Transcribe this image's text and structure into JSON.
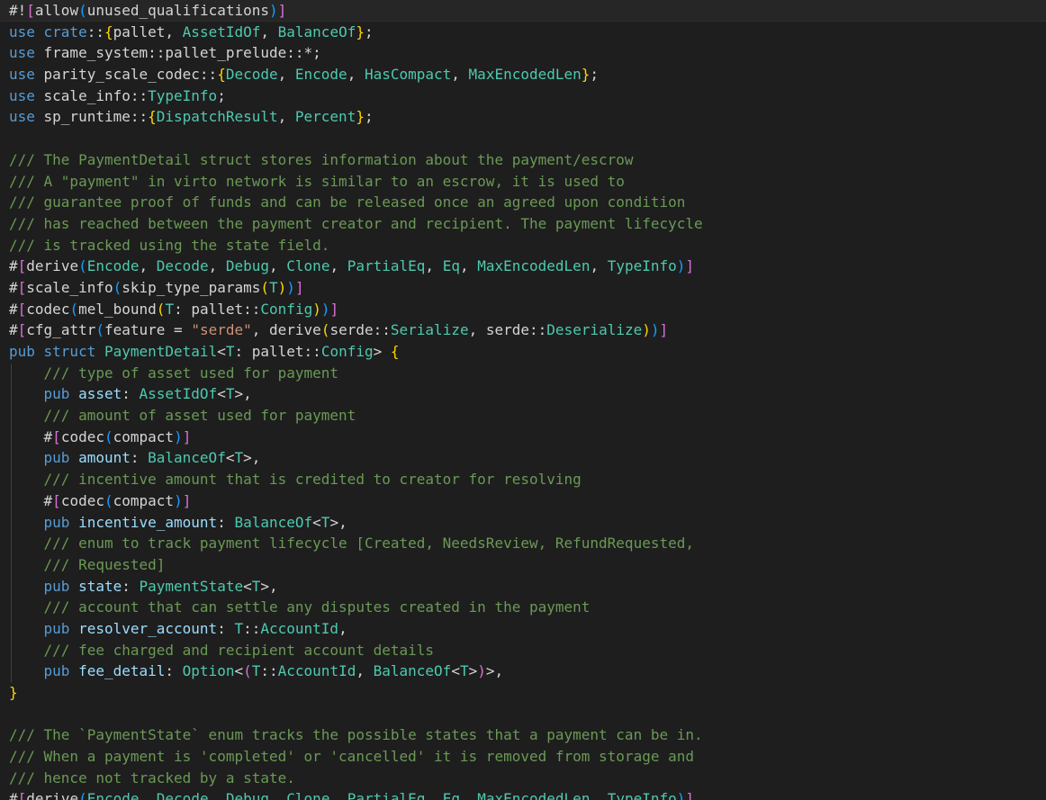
{
  "editor": {
    "lines": [
      [
        [
          "pl",
          "#!"
        ],
        [
          "b2",
          "["
        ],
        [
          "pl",
          "allow"
        ],
        [
          "b3",
          "("
        ],
        [
          "pl",
          "unused_qualifications"
        ],
        [
          "b3",
          ")"
        ],
        [
          "b2",
          "]"
        ]
      ],
      [
        [
          "kw",
          "use "
        ],
        [
          "kw",
          "crate"
        ],
        [
          "pl",
          "::"
        ],
        [
          "b1",
          "{"
        ],
        [
          "pl",
          "pallet, "
        ],
        [
          "ty",
          "AssetIdOf"
        ],
        [
          "pl",
          ", "
        ],
        [
          "ty",
          "BalanceOf"
        ],
        [
          "b1",
          "}"
        ],
        [
          "pl",
          ";"
        ]
      ],
      [
        [
          "kw",
          "use "
        ],
        [
          "pl",
          "frame_system::pallet_prelude::*;"
        ]
      ],
      [
        [
          "kw",
          "use "
        ],
        [
          "pl",
          "parity_scale_codec::"
        ],
        [
          "b1",
          "{"
        ],
        [
          "ty",
          "Decode"
        ],
        [
          "pl",
          ", "
        ],
        [
          "ty",
          "Encode"
        ],
        [
          "pl",
          ", "
        ],
        [
          "ty",
          "HasCompact"
        ],
        [
          "pl",
          ", "
        ],
        [
          "ty",
          "MaxEncodedLen"
        ],
        [
          "b1",
          "}"
        ],
        [
          "pl",
          ";"
        ]
      ],
      [
        [
          "kw",
          "use "
        ],
        [
          "pl",
          "scale_info::"
        ],
        [
          "ty",
          "TypeInfo"
        ],
        [
          "pl",
          ";"
        ]
      ],
      [
        [
          "kw",
          "use "
        ],
        [
          "pl",
          "sp_runtime::"
        ],
        [
          "b1",
          "{"
        ],
        [
          "ty",
          "DispatchResult"
        ],
        [
          "pl",
          ", "
        ],
        [
          "ty",
          "Percent"
        ],
        [
          "b1",
          "}"
        ],
        [
          "pl",
          ";"
        ]
      ],
      [],
      [
        [
          "cm",
          "/// The PaymentDetail struct stores information about the payment/escrow"
        ]
      ],
      [
        [
          "cm",
          "/// A \"payment\" in virto network is similar to an escrow, it is used to"
        ]
      ],
      [
        [
          "cm",
          "/// guarantee proof of funds and can be released once an agreed upon condition"
        ]
      ],
      [
        [
          "cm",
          "/// has reached between the payment creator and recipient. The payment lifecycle"
        ]
      ],
      [
        [
          "cm",
          "/// is tracked using the state field."
        ]
      ],
      [
        [
          "pl",
          "#"
        ],
        [
          "b2",
          "["
        ],
        [
          "pl",
          "derive"
        ],
        [
          "b3",
          "("
        ],
        [
          "ty",
          "Encode"
        ],
        [
          "pl",
          ", "
        ],
        [
          "ty",
          "Decode"
        ],
        [
          "pl",
          ", "
        ],
        [
          "ty",
          "Debug"
        ],
        [
          "pl",
          ", "
        ],
        [
          "ty",
          "Clone"
        ],
        [
          "pl",
          ", "
        ],
        [
          "ty",
          "PartialEq"
        ],
        [
          "pl",
          ", "
        ],
        [
          "ty",
          "Eq"
        ],
        [
          "pl",
          ", "
        ],
        [
          "ty",
          "MaxEncodedLen"
        ],
        [
          "pl",
          ", "
        ],
        [
          "ty",
          "TypeInfo"
        ],
        [
          "b3",
          ")"
        ],
        [
          "b2",
          "]"
        ]
      ],
      [
        [
          "pl",
          "#"
        ],
        [
          "b2",
          "["
        ],
        [
          "pl",
          "scale_info"
        ],
        [
          "b3",
          "("
        ],
        [
          "pl",
          "skip_type_params"
        ],
        [
          "b1",
          "("
        ],
        [
          "ty",
          "T"
        ],
        [
          "b1",
          ")"
        ],
        [
          "b3",
          ")"
        ],
        [
          "b2",
          "]"
        ]
      ],
      [
        [
          "pl",
          "#"
        ],
        [
          "b2",
          "["
        ],
        [
          "pl",
          "codec"
        ],
        [
          "b3",
          "("
        ],
        [
          "pl",
          "mel_bound"
        ],
        [
          "b1",
          "("
        ],
        [
          "ty",
          "T"
        ],
        [
          "pl",
          ": pallet::"
        ],
        [
          "ty",
          "Config"
        ],
        [
          "b1",
          ")"
        ],
        [
          "b3",
          ")"
        ],
        [
          "b2",
          "]"
        ]
      ],
      [
        [
          "pl",
          "#"
        ],
        [
          "b2",
          "["
        ],
        [
          "pl",
          "cfg_attr"
        ],
        [
          "b3",
          "("
        ],
        [
          "pl",
          "feature = "
        ],
        [
          "str",
          "\"serde\""
        ],
        [
          "pl",
          ", derive"
        ],
        [
          "b1",
          "("
        ],
        [
          "pl",
          "serde::"
        ],
        [
          "ty",
          "Serialize"
        ],
        [
          "pl",
          ", serde::"
        ],
        [
          "ty",
          "Deserialize"
        ],
        [
          "b1",
          ")"
        ],
        [
          "b3",
          ")"
        ],
        [
          "b2",
          "]"
        ]
      ],
      [
        [
          "kw",
          "pub "
        ],
        [
          "kw",
          "struct "
        ],
        [
          "ty",
          "PaymentDetail"
        ],
        [
          "pl",
          "<"
        ],
        [
          "ty",
          "T"
        ],
        [
          "pl",
          ": pallet::"
        ],
        [
          "ty",
          "Config"
        ],
        [
          "pl",
          "> "
        ],
        [
          "b1",
          "{"
        ]
      ],
      [
        [
          "pl",
          "    "
        ],
        [
          "cm",
          "/// type of asset used for payment"
        ]
      ],
      [
        [
          "pl",
          "    "
        ],
        [
          "kw",
          "pub "
        ],
        [
          "var",
          "asset"
        ],
        [
          "pl",
          ": "
        ],
        [
          "ty",
          "AssetIdOf"
        ],
        [
          "pl",
          "<"
        ],
        [
          "ty",
          "T"
        ],
        [
          "pl",
          ">,"
        ]
      ],
      [
        [
          "pl",
          "    "
        ],
        [
          "cm",
          "/// amount of asset used for payment"
        ]
      ],
      [
        [
          "pl",
          "    #"
        ],
        [
          "b2",
          "["
        ],
        [
          "pl",
          "codec"
        ],
        [
          "b3",
          "("
        ],
        [
          "pl",
          "compact"
        ],
        [
          "b3",
          ")"
        ],
        [
          "b2",
          "]"
        ]
      ],
      [
        [
          "pl",
          "    "
        ],
        [
          "kw",
          "pub "
        ],
        [
          "var",
          "amount"
        ],
        [
          "pl",
          ": "
        ],
        [
          "ty",
          "BalanceOf"
        ],
        [
          "pl",
          "<"
        ],
        [
          "ty",
          "T"
        ],
        [
          "pl",
          ">,"
        ]
      ],
      [
        [
          "pl",
          "    "
        ],
        [
          "cm",
          "/// incentive amount that is credited to creator for resolving"
        ]
      ],
      [
        [
          "pl",
          "    #"
        ],
        [
          "b2",
          "["
        ],
        [
          "pl",
          "codec"
        ],
        [
          "b3",
          "("
        ],
        [
          "pl",
          "compact"
        ],
        [
          "b3",
          ")"
        ],
        [
          "b2",
          "]"
        ]
      ],
      [
        [
          "pl",
          "    "
        ],
        [
          "kw",
          "pub "
        ],
        [
          "var",
          "incentive_amount"
        ],
        [
          "pl",
          ": "
        ],
        [
          "ty",
          "BalanceOf"
        ],
        [
          "pl",
          "<"
        ],
        [
          "ty",
          "T"
        ],
        [
          "pl",
          ">,"
        ]
      ],
      [
        [
          "pl",
          "    "
        ],
        [
          "cm",
          "/// enum to track payment lifecycle [Created, NeedsReview, RefundRequested,"
        ]
      ],
      [
        [
          "pl",
          "    "
        ],
        [
          "cm",
          "/// Requested]"
        ]
      ],
      [
        [
          "pl",
          "    "
        ],
        [
          "kw",
          "pub "
        ],
        [
          "var",
          "state"
        ],
        [
          "pl",
          ": "
        ],
        [
          "ty",
          "PaymentState"
        ],
        [
          "pl",
          "<"
        ],
        [
          "ty",
          "T"
        ],
        [
          "pl",
          ">,"
        ]
      ],
      [
        [
          "pl",
          "    "
        ],
        [
          "cm",
          "/// account that can settle any disputes created in the payment"
        ]
      ],
      [
        [
          "pl",
          "    "
        ],
        [
          "kw",
          "pub "
        ],
        [
          "var",
          "resolver_account"
        ],
        [
          "pl",
          ": "
        ],
        [
          "ty",
          "T"
        ],
        [
          "pl",
          "::"
        ],
        [
          "ty",
          "AccountId"
        ],
        [
          "pl",
          ","
        ]
      ],
      [
        [
          "pl",
          "    "
        ],
        [
          "cm",
          "/// fee charged and recipient account details"
        ]
      ],
      [
        [
          "pl",
          "    "
        ],
        [
          "kw",
          "pub "
        ],
        [
          "var",
          "fee_detail"
        ],
        [
          "pl",
          ": "
        ],
        [
          "ty",
          "Option"
        ],
        [
          "pl",
          "<"
        ],
        [
          "b2",
          "("
        ],
        [
          "ty",
          "T"
        ],
        [
          "pl",
          "::"
        ],
        [
          "ty",
          "AccountId"
        ],
        [
          "pl",
          ", "
        ],
        [
          "ty",
          "BalanceOf"
        ],
        [
          "pl",
          "<"
        ],
        [
          "ty",
          "T"
        ],
        [
          "pl",
          ">"
        ],
        [
          "b2",
          ")"
        ],
        [
          "pl",
          ">,"
        ]
      ],
      [
        [
          "b1",
          "}"
        ]
      ],
      [],
      [
        [
          "cm",
          "/// The `PaymentState` enum tracks the possible states that a payment can be in."
        ]
      ],
      [
        [
          "cm",
          "/// When a payment is 'completed' or 'cancelled' it is removed from storage and"
        ]
      ],
      [
        [
          "cm",
          "/// hence not tracked by a state."
        ]
      ],
      [
        [
          "pl",
          "#"
        ],
        [
          "b2",
          "["
        ],
        [
          "pl",
          "derive"
        ],
        [
          "b3",
          "("
        ],
        [
          "ty",
          "Encode"
        ],
        [
          "pl",
          ", "
        ],
        [
          "ty",
          "Decode"
        ],
        [
          "pl",
          ", "
        ],
        [
          "ty",
          "Debug"
        ],
        [
          "pl",
          ", "
        ],
        [
          "ty",
          "Clone"
        ],
        [
          "pl",
          ", "
        ],
        [
          "ty",
          "PartialEq"
        ],
        [
          "pl",
          ", "
        ],
        [
          "ty",
          "Eq"
        ],
        [
          "pl",
          ", "
        ],
        [
          "ty",
          "MaxEncodedLen"
        ],
        [
          "pl",
          ", "
        ],
        [
          "ty",
          "TypeInfo"
        ],
        [
          "b3",
          ")"
        ],
        [
          "b2",
          "]"
        ]
      ]
    ]
  }
}
